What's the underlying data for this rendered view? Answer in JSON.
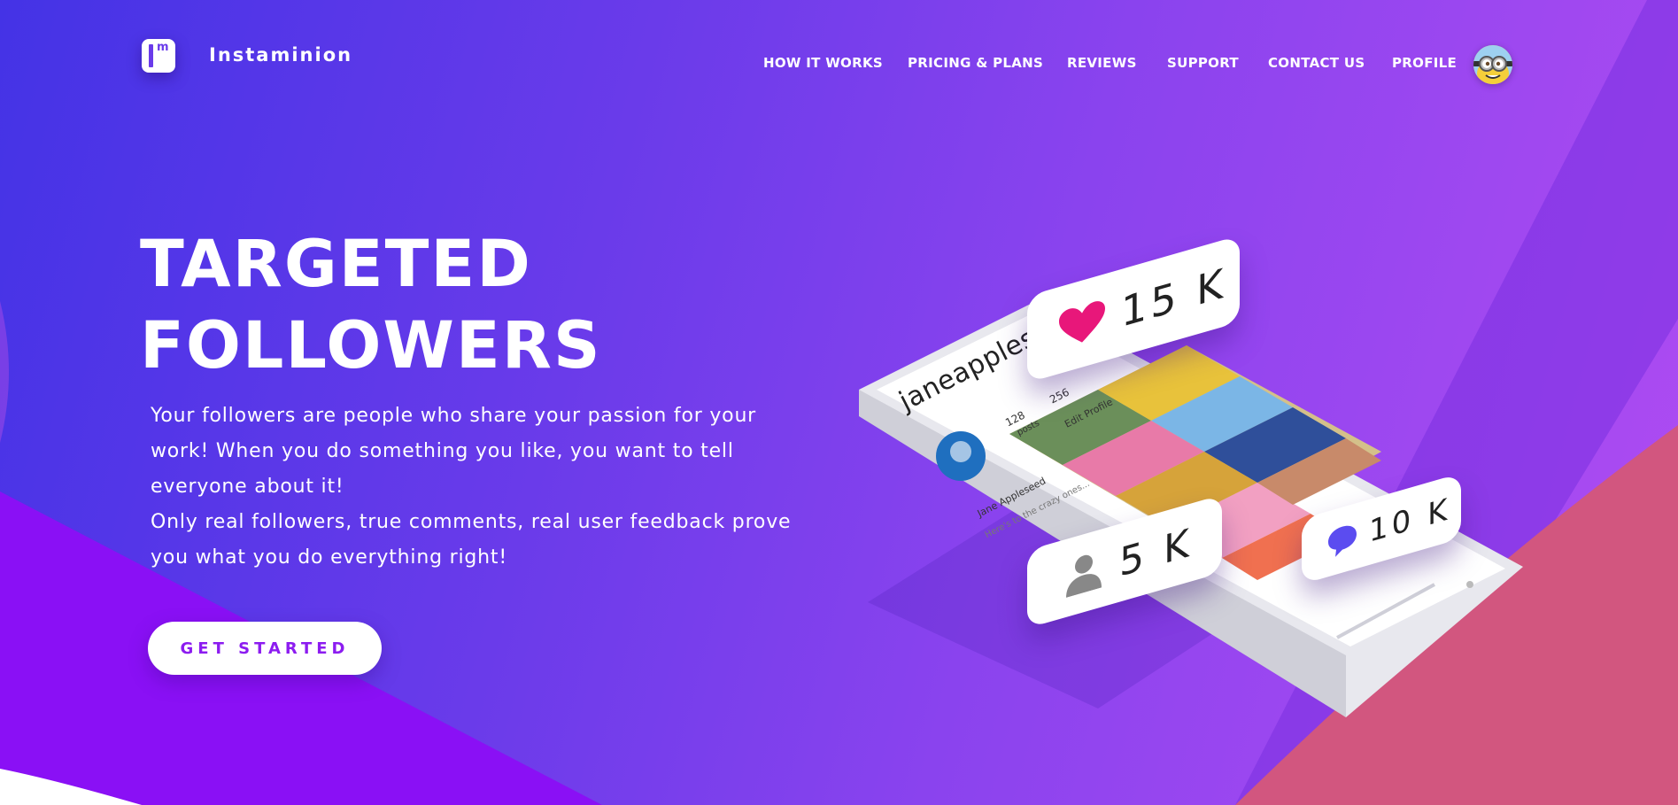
{
  "brand": {
    "name": "Instaminion",
    "logo_letter": "m"
  },
  "nav": {
    "items": [
      {
        "label": "HOW IT WORKS"
      },
      {
        "label": "PRICING & PLANS"
      },
      {
        "label": "REVIEWS"
      },
      {
        "label": "SUPPORT"
      },
      {
        "label": "CONTACT US"
      },
      {
        "label": "PROFILE"
      }
    ]
  },
  "hero": {
    "title_line1": "TARGETED",
    "title_line2": "FOLLOWERS",
    "paragraph1": "Your followers are people who share your passion for your work! When you do something you like, you want to tell everyone about it!",
    "paragraph2": "Only real followers, true comments, real user feedback prove you what you do everything right!",
    "cta_label": "GET STARTED"
  },
  "illustration": {
    "likes_count": "15 K",
    "followers_count": "5 K",
    "comments_count": "10 K",
    "profile_username": "janeappleseed",
    "posts_count": "128",
    "posts_label": "posts",
    "followers_stat": "256",
    "edit_profile_label": "Edit Profile",
    "full_name": "Jane Appleseed",
    "bio": "Here's to the crazy ones..."
  },
  "colors": {
    "accent": "#8c1cf0",
    "heart": "#e8177a",
    "chat": "#5b4cf0",
    "bg_start": "#4433e6",
    "bg_end": "#b04cf2"
  },
  "icons": [
    "heart-icon",
    "user-icon",
    "chat-icon",
    "logo-icon",
    "avatar"
  ]
}
